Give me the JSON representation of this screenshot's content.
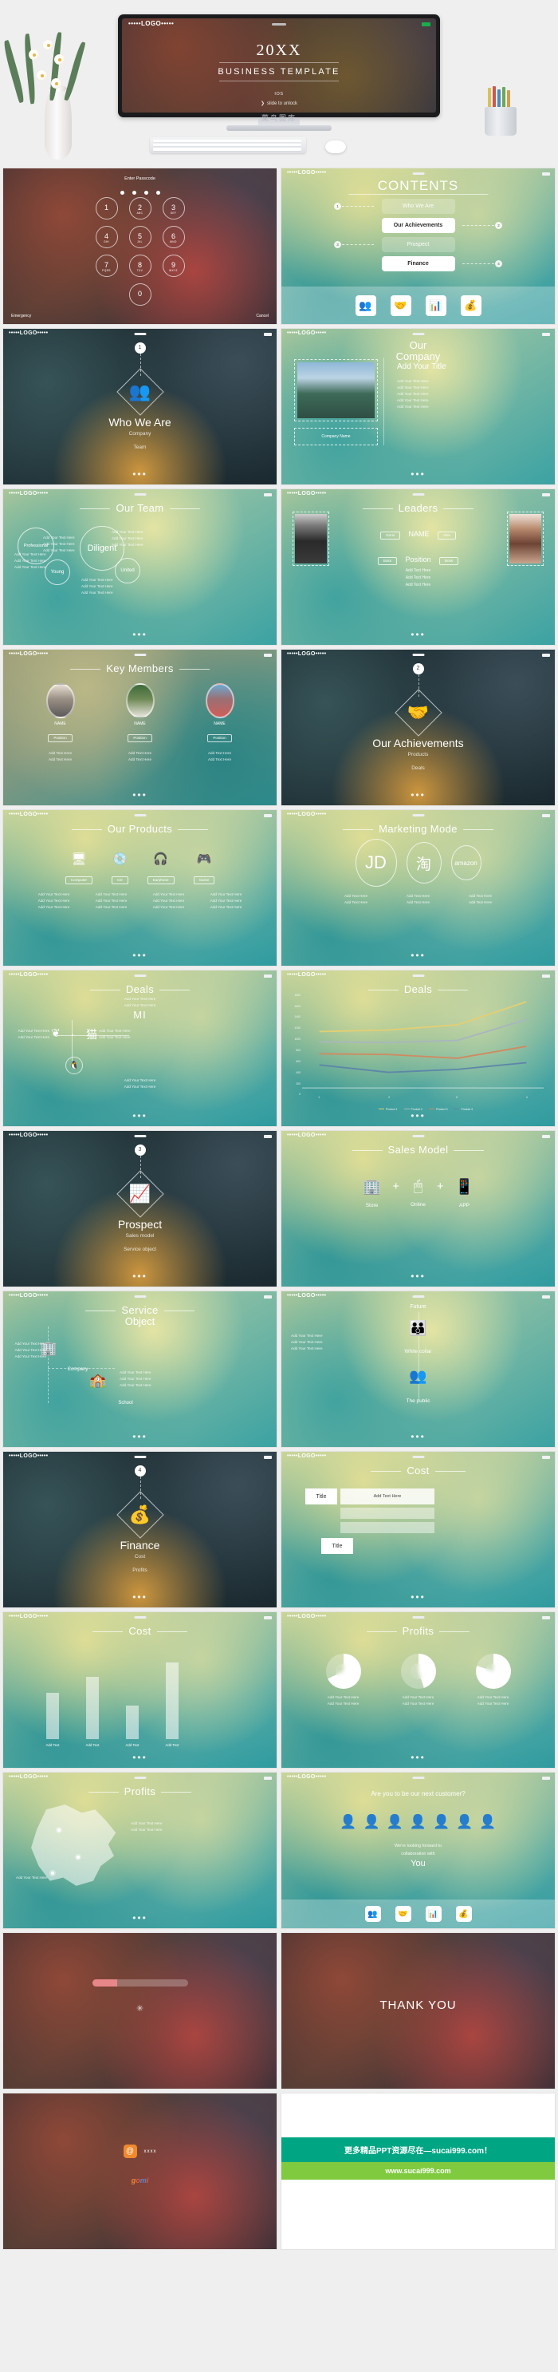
{
  "hero": {
    "status_logo": "•••••LOGO•••••",
    "year": "20XX",
    "subtitle": "BUSINESS  TEMPLATE",
    "os": "IOS",
    "unlock_arrow": "❯",
    "unlock": "slide to unlock",
    "watermark": "菜鸟图库"
  },
  "bar": {
    "logo": "•••••LOGO•••••"
  },
  "dots": "•••",
  "slides": {
    "passcode": {
      "prompt": "Enter Passcode",
      "keys": [
        {
          "n": "1",
          "s": ""
        },
        {
          "n": "2",
          "s": "ABC"
        },
        {
          "n": "3",
          "s": "DEF"
        },
        {
          "n": "4",
          "s": "GHI"
        },
        {
          "n": "5",
          "s": "JKL"
        },
        {
          "n": "6",
          "s": "MNO"
        },
        {
          "n": "7",
          "s": "PQRS"
        },
        {
          "n": "8",
          "s": "TUV"
        },
        {
          "n": "9",
          "s": "WXYZ"
        },
        {
          "n": "0",
          "s": ""
        }
      ],
      "emergency": "Emergency",
      "cancel": "Cancel"
    },
    "contents": {
      "title": "CONTENTS",
      "items": [
        {
          "num": "1",
          "label": "Who We Are",
          "style": "ghost",
          "side": "left"
        },
        {
          "num": "2",
          "label": "Our Achievements",
          "style": "solid",
          "side": "right"
        },
        {
          "num": "3",
          "label": "Prospect",
          "style": "ghost",
          "side": "left"
        },
        {
          "num": "4",
          "label": "Finance",
          "style": "solid",
          "side": "right"
        }
      ],
      "footer_icons": [
        "people-icon",
        "handshake-icon",
        "chart-icon",
        "moneybag-icon"
      ],
      "footer_glyphs": [
        "👥",
        "🤝",
        "📊",
        "💰"
      ]
    },
    "who_we_are": {
      "num": "1",
      "icon": "people-icon",
      "glyph": "👥",
      "heading": "Who We Are",
      "sub1": "Company",
      "sub2": "Team"
    },
    "our_company": {
      "title_line1": "Our",
      "title_line2": "Company",
      "company_name": "Company Name",
      "add_title": "Add Your Title",
      "text_lines": [
        "Add Your Text Here",
        "Add Your Text Here",
        "Add Your Text Here",
        "Add Your Text Here",
        "Add Your Text Here"
      ]
    },
    "our_team": {
      "title": "Our Team",
      "bubbles": [
        "Professional",
        "Young",
        "Diligent",
        "United"
      ],
      "text_left": [
        "Add Your Text Here",
        "Add Your Text Here",
        "Add Your Text Here"
      ],
      "text_mid_left": [
        "Add Your Text Here",
        "Add Your Text Here",
        "Add Your Text Here"
      ],
      "text_right": [
        "Add Your Text Here",
        "Add Your Text Here",
        "Add Your Text Here"
      ],
      "text_bottom": [
        "Add Your Text Here",
        "Add Your Text Here",
        "Add Your Text Here"
      ]
    },
    "leaders": {
      "title": "Leaders",
      "tag_left_1": "Gomi",
      "name": "NAME",
      "tag_right_1": "Alex",
      "tag_left_2": "Boss",
      "position": "Position",
      "tag_right_2": "Boss",
      "texts": [
        "Add Text Here",
        "Add Text Here",
        "Add Text Here"
      ]
    },
    "key_members": {
      "title": "Key Members",
      "members": [
        {
          "name": "NAME",
          "position": "Position",
          "texts": [
            "Add Text Here",
            "Add Text Here"
          ]
        },
        {
          "name": "NAME",
          "position": "Position",
          "texts": [
            "Add Text Here",
            "Add Text Here"
          ]
        },
        {
          "name": "NAME",
          "position": "Position",
          "texts": [
            "Add Text Here",
            "Add Text Here"
          ]
        }
      ]
    },
    "achievements": {
      "num": "2",
      "icon": "handshake-icon",
      "glyph": "🤝",
      "heading": "Our Achievements",
      "sub1": "Products",
      "sub2": "Deals"
    },
    "our_products": {
      "title": "Our Products",
      "items": [
        {
          "label": "Computer",
          "icon": "monitor-icon",
          "glyph": "🖥"
        },
        {
          "label": "CD",
          "icon": "cd-icon",
          "glyph": "💿"
        },
        {
          "label": "Earphone",
          "icon": "headphone-icon",
          "glyph": "🎧"
        },
        {
          "label": "Game",
          "icon": "gamepad-icon",
          "glyph": "🎮"
        }
      ],
      "text_lines": [
        "Add Your Text Here",
        "Add Your Text Here",
        "Add Your Text Here"
      ]
    },
    "marketing_mode": {
      "title": "Marketing Mode",
      "brands": [
        "JD",
        "淘",
        "amazon"
      ],
      "text_lines": [
        "Add Text Here",
        "Add Text Here"
      ]
    },
    "deals_icons": {
      "title": "Deals",
      "top_text": [
        "Add Your Text Here",
        "Add Your Text Here"
      ],
      "left_text": [
        "Add Your Text Here",
        "Add Your Text Here"
      ],
      "right_text": [
        "Add Your Text Here",
        "Add Your Text Here"
      ],
      "bottom_text": [
        "Add Your Text Here",
        "Add Your Text Here"
      ],
      "brands": [
        "mi-logo",
        "weibo-logo",
        "tmall-logo",
        "qq-logo"
      ]
    },
    "deals_chart": {
      "title": "Deals"
    },
    "prospect": {
      "num": "3",
      "icon": "growth-chart-icon",
      "glyph": "📈",
      "heading": "Prospect",
      "sub1": "Sales model",
      "sub2": "Service object"
    },
    "sales_model": {
      "title": "Sales Model",
      "items": [
        {
          "label": "Store",
          "icon": "building-icon",
          "glyph": "🏢"
        },
        {
          "label": "Online",
          "icon": "click-screen-icon",
          "glyph": "🖱"
        },
        {
          "label": "APP",
          "icon": "mobile-app-icon",
          "glyph": "📱"
        }
      ],
      "plus": "+"
    },
    "service_object": {
      "title_line1": "Service",
      "title_line2": "Object",
      "left_label": "Company",
      "right_label": "School",
      "texts_left": [
        "Add Your Text Here",
        "Add Your Text Here",
        "Add Your Text Here"
      ],
      "texts_right": [
        "Add Your Text Here",
        "Add Your Text Here",
        "Add Your Text Here"
      ]
    },
    "future": {
      "top_label": "Future",
      "mid_label": "White collar",
      "bottom_label": "The public",
      "texts": [
        "Add Your Text Here",
        "Add Your Text Here",
        "Add Your Text Here"
      ]
    },
    "finance": {
      "num": "4",
      "icon": "moneybag-icon",
      "glyph": "💰",
      "heading": "Finance",
      "sub1": "Cost",
      "sub2": "Profits"
    },
    "cost_cards": {
      "title": "Cost",
      "card1_title": "Title",
      "card1_sub": "Add Text Here",
      "card2_title": "Title"
    },
    "cost_bars": {
      "title": "Cost",
      "values": [
        58,
        78,
        42,
        96
      ],
      "labels": [
        "Add Text",
        "Add Text",
        "Add Text",
        "Add Text"
      ]
    },
    "profits": {
      "title": "Profits",
      "donuts": [
        68,
        45,
        80
      ],
      "texts": [
        "Add Your Text Here",
        "Add Your Text Here",
        "Add Your Text Here"
      ]
    },
    "profits_map": {
      "title": "Profits",
      "notes": [
        "Add Your Text Here",
        "Add Your Text Here",
        "Add Your Text Here"
      ]
    },
    "next_customer": {
      "title": "Are you to be our next customer?",
      "line1": "We're looking forward to",
      "line2": "collaboration with",
      "you": "You",
      "footer_glyphs": [
        "👥",
        "🤝",
        "📊",
        "💰"
      ]
    },
    "loading": {
      "bar_percent": "26"
    },
    "thank_you": {
      "text": "THANK YOU"
    },
    "contact": {
      "weibo_label": "xxxx",
      "brand": "gomi"
    },
    "promo": {
      "line1": "更多精品PPT资源尽在—sucai999.com！",
      "line2": "www.sucai999.com"
    }
  },
  "colors": {
    "teal": "#2f9ba0",
    "promo_green": "#00a583",
    "promo_light": "#7fca3f",
    "accent_orange": "#f0892c"
  },
  "chart_data": [
    {
      "type": "line",
      "title": "Deals",
      "x": [
        "1",
        "2",
        "3",
        "4"
      ],
      "xlabel": "",
      "ylabel": "",
      "ylim": [
        0,
        1800
      ],
      "yticks": [
        0,
        200,
        400,
        600,
        800,
        1000,
        1200,
        1400,
        1600,
        1800
      ],
      "grid": false,
      "legend_position": "bottom",
      "series": [
        {
          "name": "Product 1",
          "values": [
            1060,
            1090,
            1190,
            1620
          ],
          "color": "#e2cf74"
        },
        {
          "name": "Product 2",
          "values": [
            860,
            840,
            880,
            1280
          ],
          "color": "#a9b6bd"
        },
        {
          "name": "Product 3",
          "values": [
            640,
            620,
            560,
            790
          ],
          "color": "#d08a60"
        },
        {
          "name": "Product 4",
          "values": [
            430,
            300,
            350,
            470
          ],
          "color": "#5f86a8"
        }
      ]
    },
    {
      "type": "bar",
      "title": "Cost",
      "categories": [
        "Add Text",
        "Add Text",
        "Add Text",
        "Add Text"
      ],
      "values": [
        58,
        78,
        42,
        96
      ],
      "xlabel": "",
      "ylabel": "",
      "ylim": [
        0,
        100
      ],
      "grid": false
    },
    {
      "type": "pie",
      "title": "Profits",
      "labels": [
        "Add Your Text Here",
        "Add Your Text Here",
        "Add Your Text Here"
      ],
      "values": [
        68,
        45,
        80
      ],
      "note": "three donut rings, percentage fill"
    }
  ]
}
